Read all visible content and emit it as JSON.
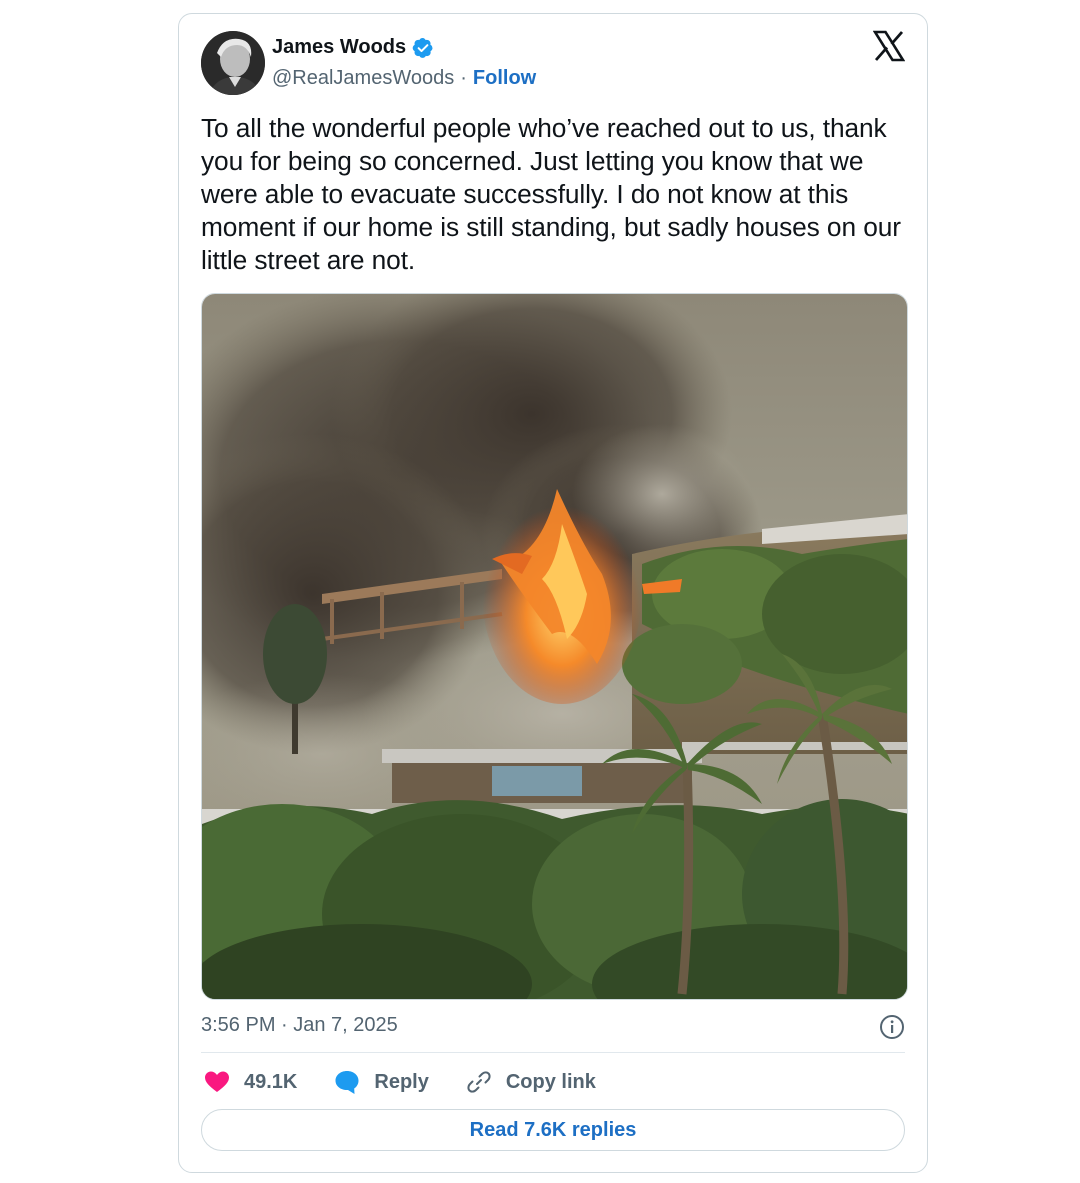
{
  "author": {
    "name": "James Woods",
    "handle": "@RealJamesWoods",
    "separator": "·",
    "follow_label": "Follow",
    "verified": true
  },
  "post": {
    "text": "To all the wonderful people who’ve reached out to us, thank you for being so concerned. Just letting you know that we were able to evacuate successfully. I do not know at this moment if our home is still standing, but sadly houses on our little street are not.",
    "timestamp": "3:56 PM · Jan 7, 2025"
  },
  "actions": {
    "like_count": "49.1K",
    "reply_label": "Reply",
    "copy_link_label": "Copy link",
    "read_replies_label": "Read 7.6K replies"
  },
  "icons": {
    "brand": "x-logo-icon",
    "verified": "verified-badge-icon",
    "info": "info-icon",
    "like": "heart-icon",
    "reply": "reply-bubble-icon",
    "link": "link-icon"
  },
  "colors": {
    "link_blue": "#1d6fc4",
    "verified_blue": "#1d9bf0",
    "like_pink": "#f91880",
    "muted": "#536471",
    "border": "#cfd9de"
  }
}
